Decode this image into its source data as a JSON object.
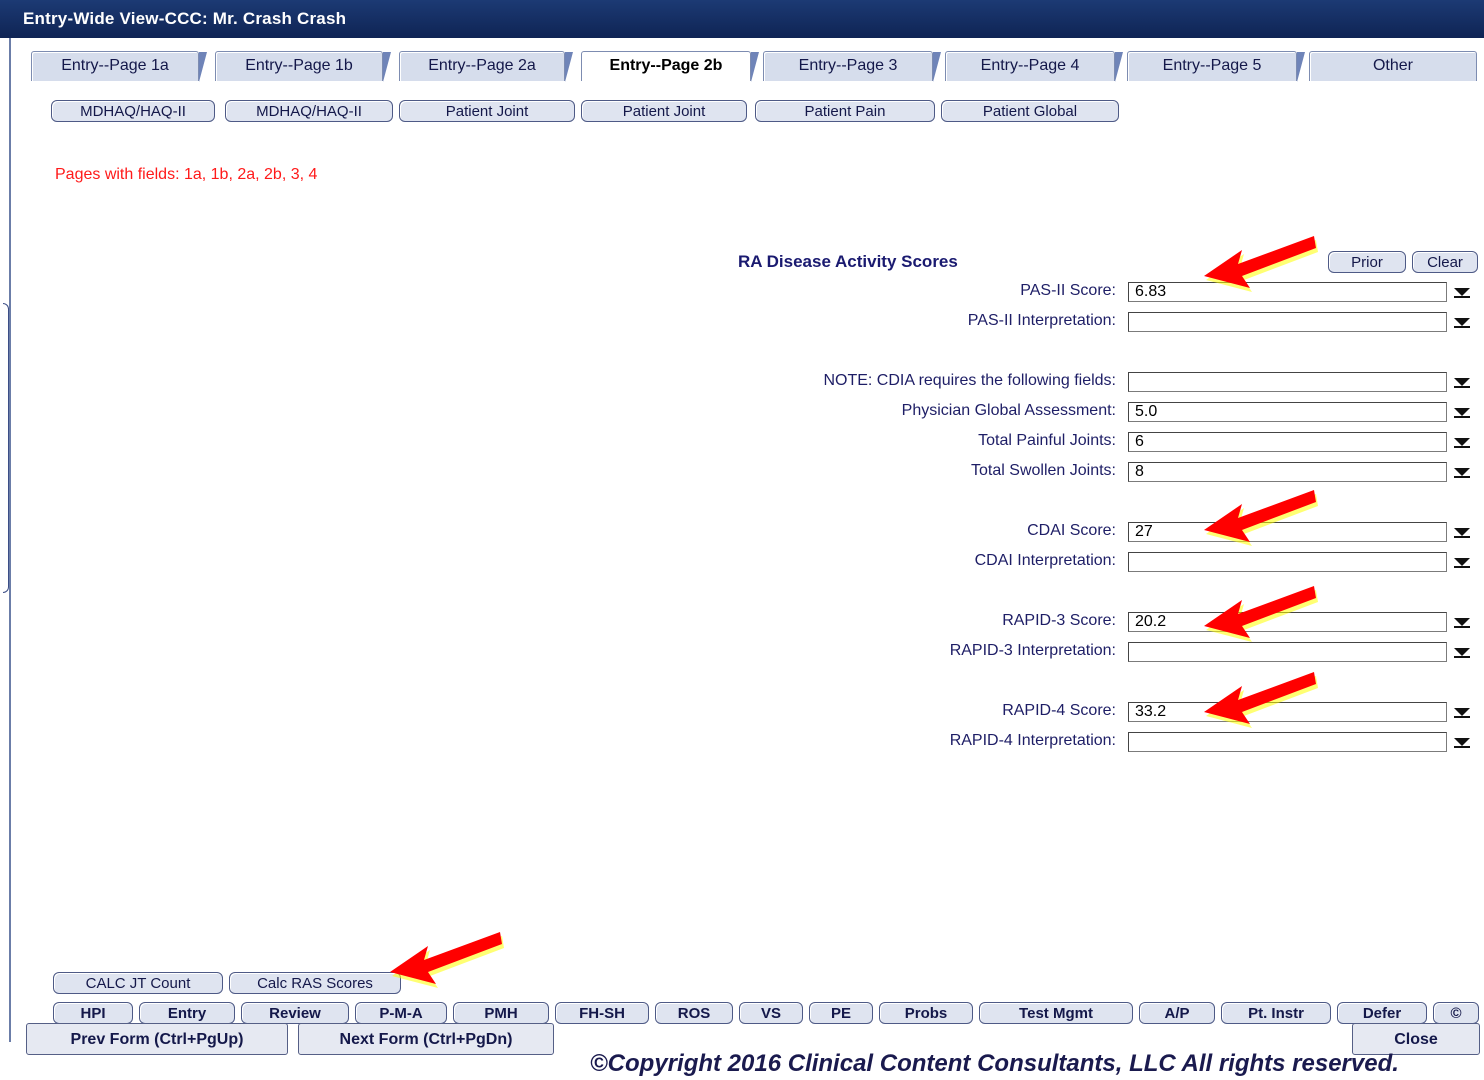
{
  "window": {
    "title": "Entry-Wide View-CCC: Mr. Crash Crash"
  },
  "tabs": [
    {
      "label": "Entry--Page 1a"
    },
    {
      "label": "Entry--Page 1b"
    },
    {
      "label": "Entry--Page 2a"
    },
    {
      "label": "Entry--Page 2b",
      "active": true
    },
    {
      "label": "Entry--Page 3"
    },
    {
      "label": "Entry--Page 4"
    },
    {
      "label": "Entry--Page 5"
    },
    {
      "label": "Other"
    }
  ],
  "form_buttons": [
    {
      "label": "MDHAQ/HAQ-II"
    },
    {
      "label": "MDHAQ/HAQ-II"
    },
    {
      "label": "Patient Joint"
    },
    {
      "label": "Patient Joint"
    },
    {
      "label": "Patient Pain"
    },
    {
      "label": "Patient Global"
    }
  ],
  "pages_note": "Pages with fields:  1a,  1b,  2a,  2b,  3,  4",
  "scores": {
    "title": "RA Disease Activity Scores",
    "prior_label": "Prior",
    "clear_label": "Clear",
    "fields": [
      {
        "label": "PAS-II Score:",
        "value": "6.83"
      },
      {
        "label": "PAS-II Interpretation:",
        "value": ""
      },
      {
        "label": "NOTE: CDIA requires the following fields:",
        "value": ""
      },
      {
        "label": "Physician Global Assessment:",
        "value": "5.0"
      },
      {
        "label": "Total Painful Joints:",
        "value": "6"
      },
      {
        "label": "Total Swollen Joints:",
        "value": "8"
      },
      {
        "label": "CDAI Score:",
        "value": "27"
      },
      {
        "label": "CDAI Interpretation:",
        "value": ""
      },
      {
        "label": "RAPID-3 Score:",
        "value": "20.2"
      },
      {
        "label": "RAPID-3 Interpretation:",
        "value": ""
      },
      {
        "label": "RAPID-4 Score:",
        "value": "33.2"
      },
      {
        "label": "RAPID-4 Interpretation:",
        "value": ""
      }
    ]
  },
  "calc_buttons": [
    {
      "label": "CALC JT Count"
    },
    {
      "label": "Calc RAS Scores"
    }
  ],
  "nav_buttons": [
    {
      "label": "HPI"
    },
    {
      "label": "Entry"
    },
    {
      "label": "Review"
    },
    {
      "label": "P-M-A"
    },
    {
      "label": "PMH"
    },
    {
      "label": "FH-SH"
    },
    {
      "label": "ROS"
    },
    {
      "label": "VS"
    },
    {
      "label": "PE"
    },
    {
      "label": "Probs"
    },
    {
      "label": "Test Mgmt"
    },
    {
      "label": "A/P"
    },
    {
      "label": "Pt. Instr"
    },
    {
      "label": "Defer"
    },
    {
      "label": "©"
    }
  ],
  "footer": {
    "prev_label": "Prev Form (Ctrl+PgUp)",
    "next_label": "Next Form (Ctrl+PgDn)",
    "close_label": "Close",
    "copyright": "©Copyright 2016 Clinical Content Consultants, LLC All rights reserved."
  },
  "colors": {
    "annotation_arrow": "#ff0000",
    "arrow_glow": "#ffff00",
    "pages_note": "#ff1a1a"
  }
}
